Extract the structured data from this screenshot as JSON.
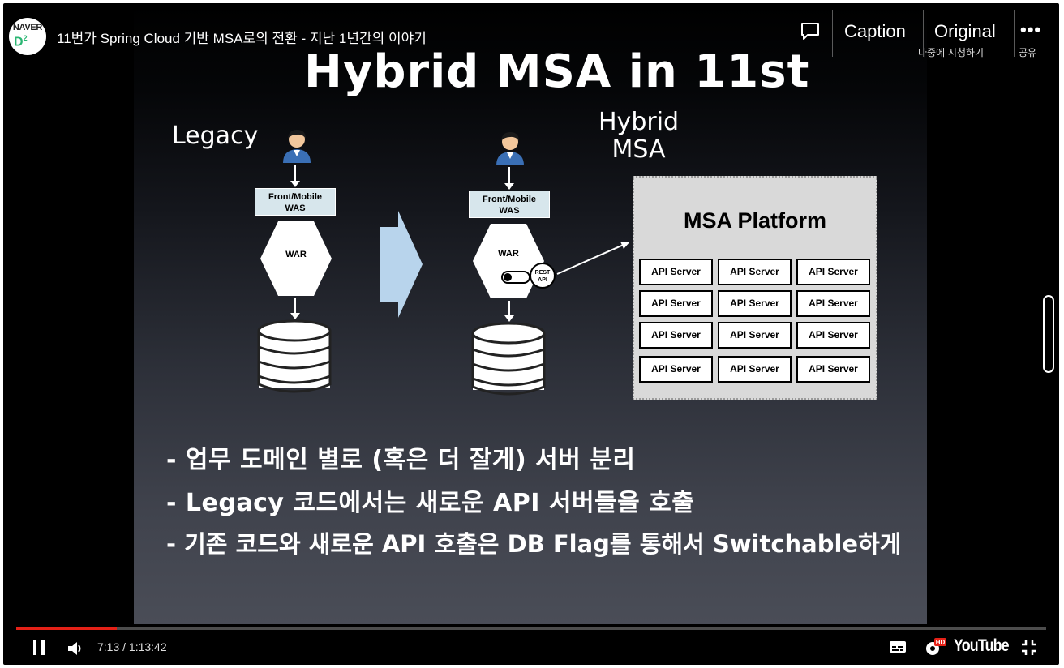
{
  "header": {
    "channel_logo_text": "NAVER",
    "channel_logo_mark": "D",
    "channel_logo_sup": "2",
    "video_title": "11번가 Spring Cloud 기반 MSA로의 전환 - 지난 1년간의 이야기",
    "caption_label": "Caption",
    "original_label": "Original",
    "watch_later_label": "나중에 시청하기",
    "share_label": "공유"
  },
  "slide": {
    "title": "Hybrid MSA in 11st",
    "legacy_label": "Legacy",
    "hybrid_label_line1": "Hybrid",
    "hybrid_label_line2": "MSA",
    "left_was": {
      "line1": "Front/Mobile",
      "line2": "WAS"
    },
    "left_war": "WAR",
    "right_was": {
      "line1": "Front/Mobile",
      "line2": "WAS"
    },
    "right_war": "WAR",
    "rest_api_line1": "REST",
    "rest_api_line2": "API",
    "msa_platform_title": "MSA Platform",
    "api_servers": [
      "API Server",
      "API Server",
      "API Server",
      "API Server",
      "API Server",
      "API Server",
      "API Server",
      "API Server",
      "API Server",
      "API Server",
      "API Server",
      "API Server"
    ],
    "bullets": [
      "- 업무 도메인 별로 (혹은 더 잘게) 서버 분리",
      "- Legacy 코드에서는 새로운 API 서버들을 호출",
      "- 기존 코드와 새로운 API 호출은 DB Flag를 통해서 Switchable하게"
    ]
  },
  "controls": {
    "current_time": "7:13",
    "duration": "1:13:42",
    "time_separator": " / ",
    "progress_fraction": 0.098,
    "youtube_label": "YouTube",
    "hd_badge": "HD",
    "accent_color": "#e52117"
  },
  "icons": [
    "comment-icon",
    "more-icon",
    "pause-icon",
    "volume-icon",
    "subtitles-icon",
    "settings-icon",
    "exit-fullscreen-icon",
    "user-icon",
    "database-icon",
    "arrow-right-icon"
  ]
}
